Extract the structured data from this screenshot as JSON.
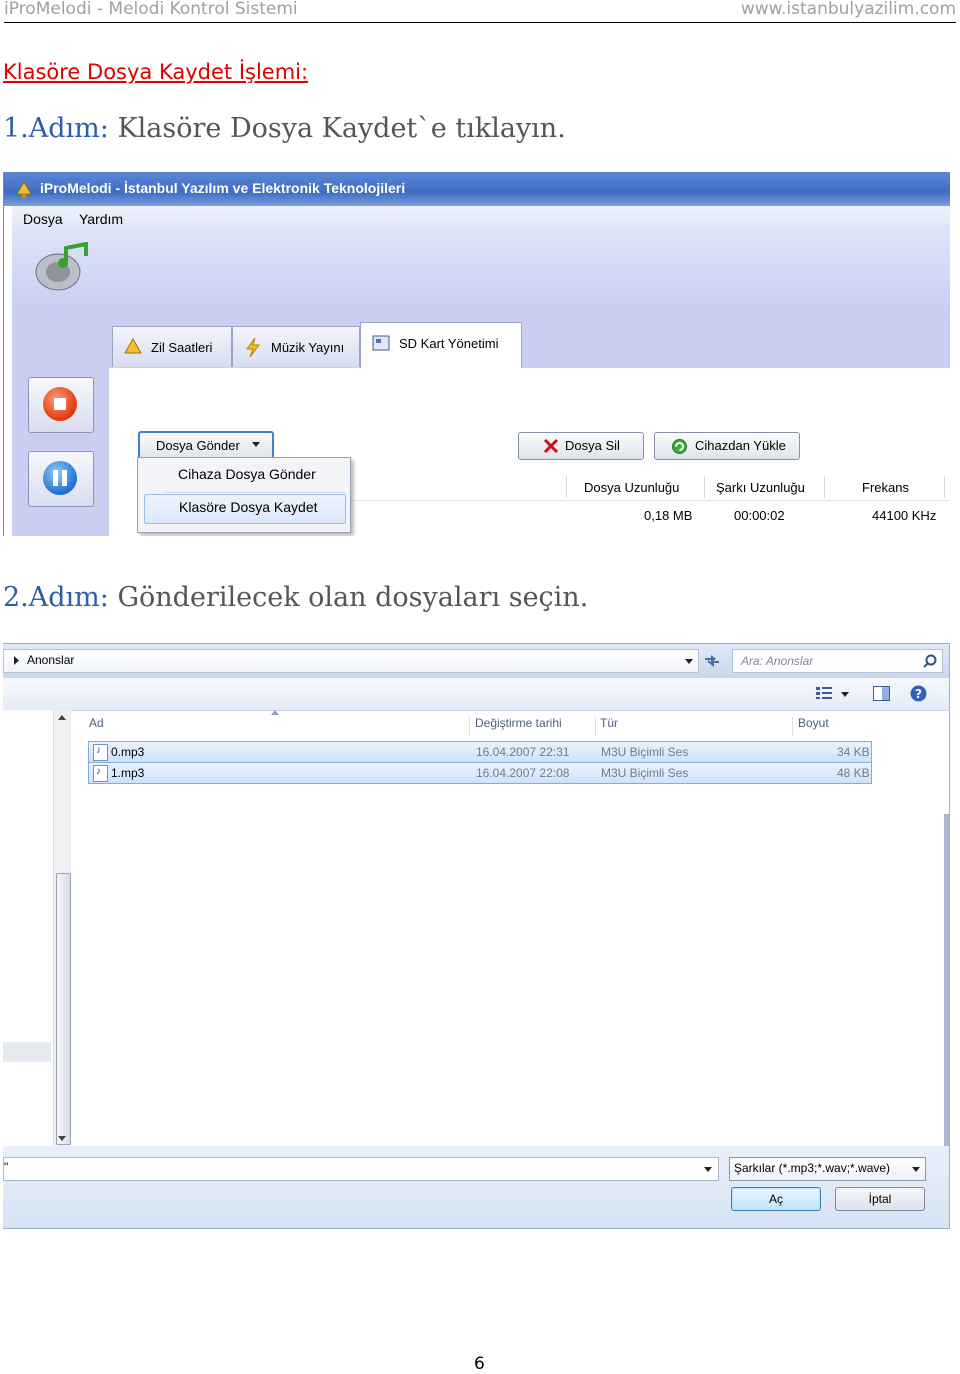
{
  "header": {
    "left": "iProMelodi - Melodi Kontrol Sistemi",
    "right": "www.istanbulyazilim.com"
  },
  "section_title": "Klasöre Dosya Kaydet İşlemi:",
  "step1": {
    "num": "1.Adım:",
    "text": " Klasöre Dosya Kaydet`e tıklayın."
  },
  "step2": {
    "num": "2.Adım:",
    "text": " Gönderilecek olan dosyaları seçin."
  },
  "page_number": "6",
  "app1": {
    "title": "iProMelodi - İstanbul Yazılım ve Elektronik Teknolojileri",
    "menu": [
      "Dosya",
      "Yardım"
    ],
    "tabs": [
      "Zil Saatleri",
      "Müzik Yayını",
      "SD Kart Yönetimi"
    ],
    "dropdown_button": "Dosya Gönder",
    "dropdown_items": [
      "Cihaza Dosya Gönder",
      "Klasöre Dosya Kaydet"
    ],
    "delete_button": "Dosya Sil",
    "load_button": "Cihazdan Yükle",
    "columns": [
      "Dosya Uzunluğu",
      "Şarkı Uzunluğu",
      "Frekans"
    ],
    "row": [
      "0,18 MB",
      "00:00:02",
      "44100 KHz"
    ],
    "colors": {
      "title_bar": "#4a78cc",
      "panel": "#c9cef2"
    }
  },
  "dialog2": {
    "breadcrumb": "Anonslar",
    "search_placeholder": "Ara: Anonslar",
    "columns": [
      "Ad",
      "Değiştirme tarihi",
      "Tür",
      "Boyut"
    ],
    "files": [
      {
        "name": "0.mp3",
        "date": "16.04.2007 22:31",
        "type": "M3U Biçimli Ses",
        "size": "34 KB"
      },
      {
        "name": "1.mp3",
        "date": "16.04.2007 22:08",
        "type": "M3U Biçimli Ses",
        "size": "48 KB"
      }
    ],
    "filename_value": "\"",
    "filter": "Şarkılar (*.mp3;*.wav;*.wave)",
    "open_button": "Aç",
    "cancel_button": "İptal"
  }
}
